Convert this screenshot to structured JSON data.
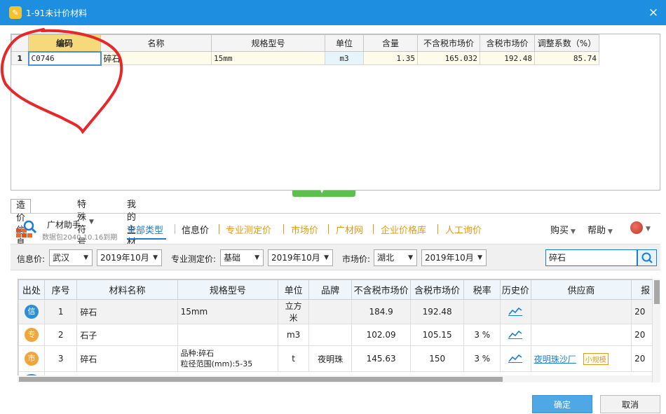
{
  "window": {
    "title": "1-91未计价材料",
    "close_icon": "×"
  },
  "top_grid": {
    "headers": [
      "编码",
      "名称",
      "规格型号",
      "单位",
      "含量",
      "不含税市场价",
      "含税市场价",
      "调整系数（%）"
    ],
    "rows": [
      {
        "no": "1",
        "code": "C0746",
        "name": "碎石",
        "spec": "15mm",
        "unit": "m3",
        "qty": "1.35",
        "price_ex_tax": "165.032",
        "price_inc_tax": "192.48",
        "adj": "85.74"
      }
    ]
  },
  "lower_tabs": [
    "造价信息库",
    "特殊符号",
    "我的主材库"
  ],
  "brand": {
    "name": "广材助手",
    "sub": "数据包2040.10.16到期"
  },
  "category_tabs": [
    "全部类型",
    "信息价",
    "专业测定价",
    "市场价",
    "广材网",
    "企业价格库",
    "人工询价"
  ],
  "right_menu": {
    "buy": "购买",
    "help": "帮助"
  },
  "filters": {
    "info_label": "信息价:",
    "info_region": "武汉",
    "info_period": "2019年10月",
    "pro_label": "专业测定价:",
    "pro_type": "基础",
    "pro_period": "2019年10月",
    "market_label": "市场价:",
    "market_region": "湖北",
    "market_period": "2019年10月",
    "search_value": "碎石"
  },
  "lower_grid": {
    "headers": [
      "出处",
      "序号",
      "材料名称",
      "规格型号",
      "单位",
      "品牌",
      "不含税市场价",
      "含税市场价",
      "税率",
      "历史价",
      "供应商",
      "报"
    ],
    "rows": [
      {
        "src": "信",
        "no": "1",
        "name": "碎石",
        "spec1": "15mm",
        "spec2": "",
        "unit": "立方米",
        "brand": "",
        "ex": "184.9",
        "inc": "192.48",
        "rate": "",
        "supplier": "",
        "tag": "",
        "last": "20"
      },
      {
        "src": "专",
        "no": "2",
        "name": "石子",
        "spec1": "",
        "spec2": "",
        "unit": "m3",
        "brand": "",
        "ex": "102.09",
        "inc": "105.15",
        "rate": "3 %",
        "supplier": "",
        "tag": "",
        "last": "20"
      },
      {
        "src": "市",
        "no": "3",
        "name": "碎石",
        "spec1": "品种:碎石",
        "spec2": "粒径范围(mm):5-35",
        "unit": "t",
        "brand": "夜明珠",
        "ex": "145.63",
        "inc": "150",
        "rate": "3 %",
        "supplier": "夜明珠沙厂",
        "tag": "小规模",
        "last": "20"
      }
    ]
  },
  "buttons": {
    "confirm": "确定",
    "cancel": "取消"
  },
  "colors": {
    "title_bar": "#1e8fe0",
    "accent_blue": "#1b7ed4",
    "orange": "#e39a12",
    "badge_info": "#2b8fd8",
    "badge_pro": "#f3a53a",
    "badge_market": "#f3a53a",
    "annotation_red": "#e6282b"
  }
}
